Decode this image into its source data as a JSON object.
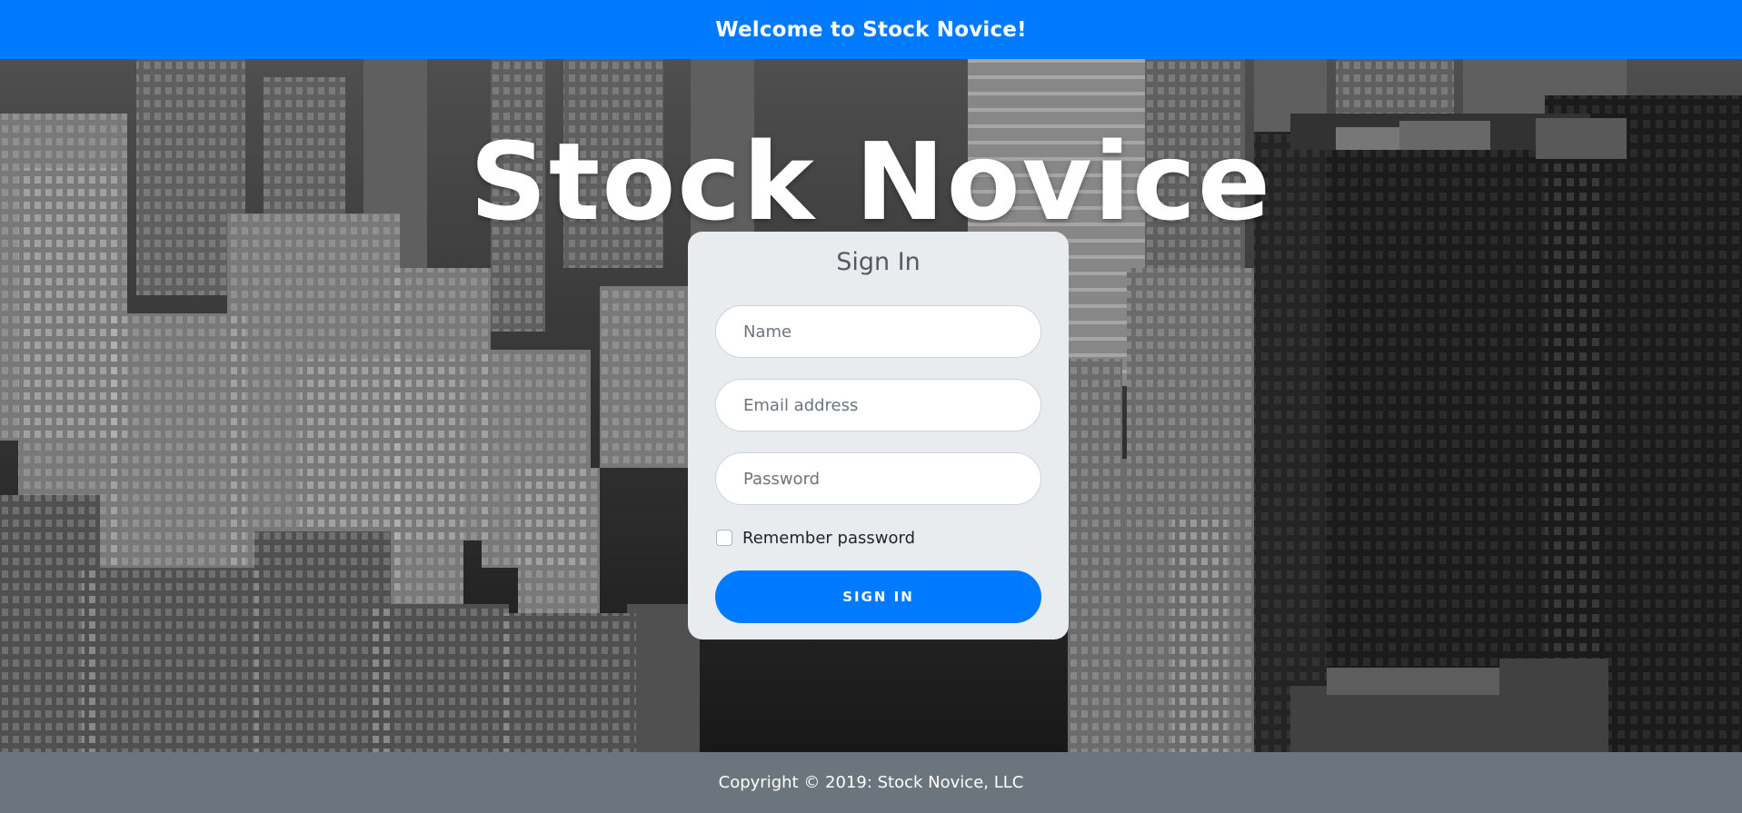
{
  "banner": {
    "text": "Welcome to Stock Novice!",
    "background_color": "#007bff"
  },
  "hero": {
    "title": "Stock Novice",
    "background": "black-and-white aerial city skyline photo"
  },
  "signin": {
    "title": "Sign In",
    "name_placeholder": "Name",
    "name_value": "",
    "email_placeholder": "Email address",
    "email_value": "",
    "password_placeholder": "Password",
    "password_value": "",
    "remember_label": "Remember password",
    "remember_checked": false,
    "button_label": "SIGN IN",
    "button_color": "#007bff"
  },
  "footer": {
    "text": "Copyright © 2019: Stock Novice, LLC",
    "background_color": "#6c757d"
  }
}
